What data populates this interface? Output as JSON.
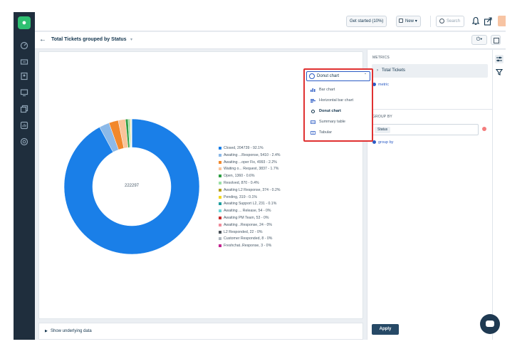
{
  "brand": {
    "accent": "#2c5cc5",
    "nav_bg": "#1f2e3d",
    "logo_color": "#2fbf71"
  },
  "topbar": {
    "get_started_label": "Get started (10%)",
    "new_label": "New",
    "search_placeholder": "Search",
    "icons": [
      "bell-icon",
      "share-icon",
      "avatar"
    ]
  },
  "nav_icons": [
    "dashboard-icon",
    "tickets-icon",
    "contacts-icon",
    "monitor-icon",
    "solutions-icon",
    "reports-icon",
    "settings-icon"
  ],
  "header": {
    "back_icon": "back-arrow-icon",
    "title": "Total Tickets grouped by Status",
    "title_caret": "▾",
    "power_caret": "▾"
  },
  "chart_dropdown": {
    "selected": "Donut chart",
    "options": [
      {
        "label": "Bar chart",
        "icon": "bar-chart-icon"
      },
      {
        "label": "Horizontal bar chart",
        "icon": "horizontal-bar-icon"
      },
      {
        "label": "Donut chart",
        "icon": "donut-icon"
      },
      {
        "label": "Summary table",
        "icon": "summary-table-icon"
      },
      {
        "label": "Tabular",
        "icon": "tabular-icon"
      }
    ]
  },
  "chart_data": {
    "type": "pie",
    "variant": "donut",
    "center_label": "222297",
    "legend_position": "right",
    "slices": [
      {
        "name": "Closed",
        "value": 204739,
        "percent": 92.1,
        "label": "Closed,  204739 - 92.1%",
        "color": "#1a7fe8"
      },
      {
        "name": "Awaiting ...Response",
        "value": 5410,
        "percent": 2.4,
        "label": "Awaiting ...Response,  5410 - 2.4%",
        "color": "#8cb9e8"
      },
      {
        "name": "Awaiting ...oper Fix",
        "value": 4993,
        "percent": 2.2,
        "label": "Awaiting ...oper Fix,  4993 - 2.2%",
        "color": "#f2882b"
      },
      {
        "name": "Waiting o... Request",
        "value": 3837,
        "percent": 1.7,
        "label": "Waiting o... Request,  3837 - 1.7%",
        "color": "#f9c49a"
      },
      {
        "name": "Open",
        "value": 1360,
        "percent": 0.6,
        "label": "Open,  1360 - 0.6%",
        "color": "#2f9e44"
      },
      {
        "name": "Resolved",
        "value": 870,
        "percent": 0.4,
        "label": "Resolved,  870 - 0.4%",
        "color": "#9be0a7"
      },
      {
        "name": "Awaiting L2 Response",
        "value": 374,
        "percent": 0.2,
        "label": "Awaiting L2 Response,  374 - 0.2%",
        "color": "#b5a01a"
      },
      {
        "name": "Pending",
        "value": 319,
        "percent": 0.1,
        "label": "Pending,  319 - 0.1%",
        "color": "#f2d51f"
      },
      {
        "name": "Awaiting Support L2",
        "value": 231,
        "percent": 0.1,
        "label": "Awaiting Support L2,  231 - 0.1%",
        "color": "#1f9e9e"
      },
      {
        "name": "Awaiting ... Release",
        "value": 54,
        "percent": 0,
        "label": "Awaiting ... Release,  54 - 0%",
        "color": "#6ed6d6"
      },
      {
        "name": "Awaiting PM Team",
        "value": 53,
        "percent": 0,
        "label": "Awaiting PM Team,  53 - 0%",
        "color": "#c92a2a"
      },
      {
        "name": "Awaiting ..Response",
        "value": 24,
        "percent": 0,
        "label": "Awaiting ..Response,  24 - 0%",
        "color": "#f08c9b"
      },
      {
        "name": "L2 Responded",
        "value": 22,
        "percent": 0,
        "label": "L2 Responded,  22 - 0%",
        "color": "#495057"
      },
      {
        "name": "Customer Responded",
        "value": 8,
        "percent": 0,
        "label": "Customer Responded,  8 - 0%",
        "color": "#adb5bd"
      },
      {
        "name": "Freshchat..Response",
        "value": 3,
        "percent": 0,
        "label": "Freshchat..Response,  3 - 0%",
        "color": "#c2258f"
      }
    ]
  },
  "underlying": {
    "label": "Show underlying data",
    "caret": "▶"
  },
  "right_panel": {
    "metrics_title": "METRICS",
    "metric_name": "Total Tickets",
    "metric_chevron": "›",
    "add_metric": "metric",
    "group_by_title": "GROUP BY",
    "group_by_value": "Status",
    "add_group_by": "group by",
    "apply_label": "Apply"
  },
  "side_tools": [
    "settings-sliders-icon",
    "filter-icon"
  ]
}
